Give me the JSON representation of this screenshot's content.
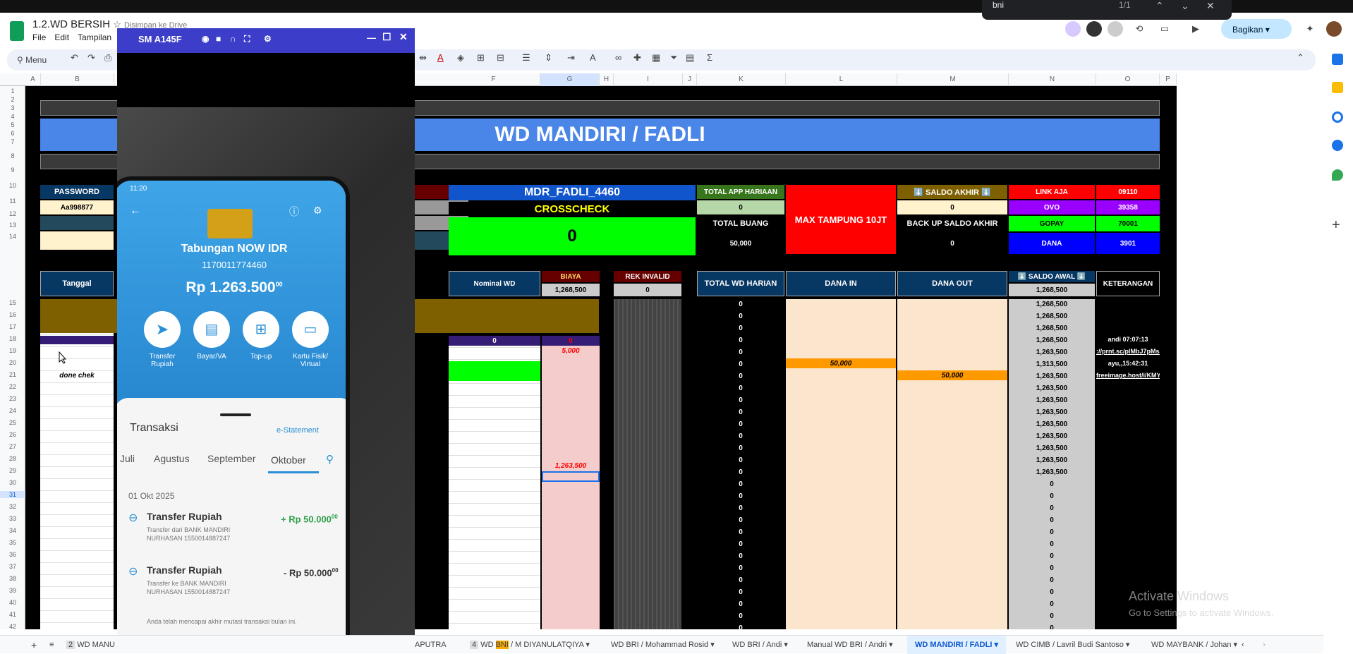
{
  "find": {
    "query": "bni",
    "count": "1/1"
  },
  "doc": {
    "title": "1.2.WD BERSIH",
    "saved": "Disimpan ke Drive",
    "menus": [
      "File",
      "Edit",
      "Tampilan"
    ],
    "search_menu": "Menu"
  },
  "share": {
    "label": "Bagikan"
  },
  "columns": [
    "A",
    "B",
    "C",
    "D",
    "E",
    "F",
    "G",
    "H",
    "I",
    "J",
    "K",
    "L",
    "M",
    "N",
    "O",
    "P"
  ],
  "rows": [
    "1",
    "2",
    "3",
    "4",
    "5",
    "6",
    "7",
    "8",
    "9",
    "10",
    "11",
    "12",
    "13",
    "14",
    "15",
    "16",
    "17",
    "18",
    "19",
    "20",
    "21",
    "22",
    "23",
    "24",
    "25",
    "26",
    "27",
    "28",
    "29",
    "30",
    "31",
    "32",
    "33",
    "34",
    "35",
    "36",
    "37",
    "38",
    "39",
    "40",
    "41",
    "42"
  ],
  "sheet": {
    "title": "WD MANDIRI / FADLI",
    "password_label": "PASSWORD",
    "password_value": "Aa998877",
    "account": "MDR_FADLI_4460",
    "crosscheck": "CROSSCHECK",
    "crosscheck_value": "0",
    "total_app_harian": "TOTAL APP HARIAAN",
    "total_app_value": "0",
    "total_buang": "TOTAL BUANG",
    "total_buang_value": "50,000",
    "max_tampung": "MAX TAMPUNG 10JT",
    "saldo_akhir": "⬇️ SALDO AKHIR ⬇️",
    "saldo_akhir_value": "0",
    "backup_saldo": "BACK UP SALDO AKHIR",
    "backup_value": "0",
    "wallets": [
      {
        "name": "LINK AJA",
        "value": "09110"
      },
      {
        "name": "OVO",
        "value": "39358"
      },
      {
        "name": "GOPAY",
        "value": "70001"
      },
      {
        "name": "DANA",
        "value": "3901"
      }
    ],
    "headers": {
      "tanggal": "Tanggal",
      "nominal_wd": "Nominal WD",
      "biaya": "BIAYA",
      "biaya_total": "1,268,500",
      "rek_invalid": "REK INVALID",
      "rek_invalid_value": "0",
      "total_wd_harian": "TOTAL WD HARIAN",
      "dana_in": "DANA IN",
      "dana_out": "DANA OUT",
      "saldo_awal": "⬇️ SALDO AWAL ⬇️",
      "saldo_awal_value": "1,268,500",
      "keterangan": "KETERANGAN"
    },
    "row18": {
      "nominal": "0",
      "biaya": "0"
    },
    "row19": {
      "biaya": "5,000"
    },
    "row30": {
      "biaya": "1,263,500"
    },
    "done_chek": "done chek",
    "dana_in_20": "50,000",
    "dana_out_21": "50,000",
    "keterangan": {
      "r18": "andi 07:07:13",
      "r19": "://prnt.sc/plMbJ7pMsacl",
      "r20": "ayu,,15:42:31",
      "r21": "freeimage.host/i/KMY0I"
    },
    "total_wd": [
      "0",
      "0",
      "0",
      "0",
      "0",
      "0",
      "0",
      "0",
      "0",
      "0",
      "0",
      "0",
      "0",
      "0",
      "0",
      "0",
      "0",
      "0",
      "0",
      "0",
      "0",
      "0",
      "0",
      "0",
      "0",
      "0",
      "0",
      "0"
    ],
    "saldo_awal_col": [
      "1,268,500",
      "1,268,500",
      "1,268,500",
      "1,268,500",
      "1,263,500",
      "1,313,500",
      "1,263,500",
      "1,263,500",
      "1,263,500",
      "1,263,500",
      "1,263,500",
      "1,263,500",
      "1,263,500",
      "1,263,500",
      "1,263,500",
      "0",
      "0",
      "0",
      "0",
      "0",
      "0",
      "0",
      "0",
      "0",
      "0",
      "0",
      "0",
      "0"
    ]
  },
  "phone": {
    "window_title": "SM A145F",
    "time": "11:20",
    "account_name": "Tabungan NOW IDR",
    "account_no": "1170011774460",
    "balance": "Rp 1.263.500",
    "balance_sup": "00",
    "actions": [
      "Transfer Rupiah",
      "Bayar/VA",
      "Top-up",
      "Kartu Fisik/ Virtual"
    ],
    "tx_title": "Transaksi",
    "estatement": "e-Statement",
    "months": [
      "Juli",
      "Agustus",
      "September",
      "Oktober"
    ],
    "date": "01 Okt 2025",
    "tx": [
      {
        "title": "Transfer Rupiah",
        "desc1": "Transfer dari BANK MANDIRI",
        "desc2": "NURHASAN 1550014887247",
        "amount": "+ Rp 50.000",
        "sup": "00"
      },
      {
        "title": "Transfer Rupiah",
        "desc1": "Transfer ke BANK MANDIRI",
        "desc2": "NURHASAN 1550014887247",
        "amount": "- Rp 50.000",
        "sup": "00"
      }
    ],
    "footer": "Anda telah mencapai akhir mutasi transaksi bulan ini."
  },
  "tabs": [
    "2",
    "WD MANU",
    "APUTRA",
    "4",
    "WD",
    "BNI",
    "/ M DIYANULATQIYA",
    "WD BRI / Mohammad Rosid",
    "WD BRI / Andi",
    "Manual WD BRI / Andri",
    "WD MANDIRI / FADLI",
    "WD CIMB / Lavril Budi Santoso",
    "WD MAYBANK / Johan"
  ],
  "watermark": {
    "line1": "Activate Windows",
    "line2": "Go to Settings to activate Windows."
  }
}
